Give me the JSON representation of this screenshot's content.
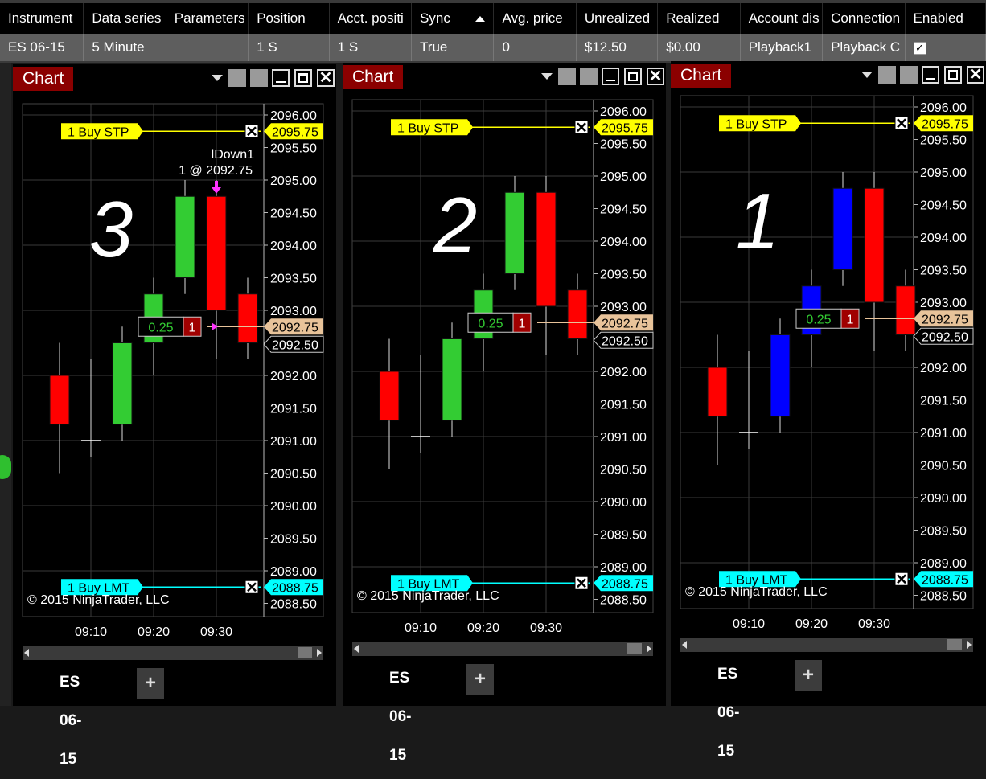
{
  "grid": {
    "columns": [
      "Instrument",
      "Data series",
      "Parameters",
      "Position",
      "Acct. positi",
      "Sync",
      "Avg. price",
      "Unrealized",
      "Realized",
      "Account dis",
      "Connection",
      "Enabled"
    ],
    "row": [
      "ES 06-15",
      "5 Minute",
      "",
      "1 S",
      "1 S",
      "True",
      "0",
      "$12.50",
      "$0.00",
      "Playback1",
      "Playback C",
      ""
    ]
  },
  "windows": [
    {
      "title": "Chart",
      "tab": "ES 06-15",
      "number": "3",
      "pos_qty": "1",
      "pos_pnl": "0.25",
      "trade_label": "lDown1",
      "trade_fill": "1 @ 2092.75"
    },
    {
      "title": "Chart",
      "tab": "ES 06-15",
      "number": "2",
      "pos_qty": "1",
      "pos_pnl": "0.25"
    },
    {
      "title": "Chart",
      "tab": "ES 06-15",
      "number": "1",
      "pos_qty": "1",
      "pos_pnl": "0.25"
    }
  ],
  "copyright": "© 2015 NinjaTrader, LLC",
  "plus_label": "+",
  "colors": {
    "up": "#33cc33",
    "down": "#ff0000",
    "up_blue": "#0000ff",
    "stop": "#ffff00",
    "limit": "#00ffff",
    "last": "#e8c39a",
    "title_red": "#8b0000"
  },
  "chart_data": [
    {
      "type": "candlestick",
      "x": [
        "09:10",
        "09:20",
        "09:30"
      ],
      "y_ticks": [
        "2096.00",
        "2095.50",
        "2095.00",
        "2094.50",
        "2094.00",
        "2093.50",
        "2093.00",
        "2092.50",
        "2092.00",
        "2091.50",
        "2091.00",
        "2090.50",
        "2090.00",
        "2089.50",
        "2089.00",
        "2088.50"
      ],
      "ylim": [
        2088.5,
        2096
      ],
      "candles": [
        {
          "o": 2092.0,
          "h": 2092.5,
          "l": 2090.5,
          "c": 2091.25
        },
        {
          "o": 2091.0,
          "h": 2092.25,
          "l": 2090.75,
          "c": 2091.0
        },
        {
          "o": 2091.25,
          "h": 2092.75,
          "l": 2091.0,
          "c": 2092.5
        },
        {
          "o": 2092.5,
          "h": 2093.5,
          "l": 2092.0,
          "c": 2093.25
        },
        {
          "o": 2093.5,
          "h": 2095.0,
          "l": 2093.25,
          "c": 2094.75
        },
        {
          "o": 2094.75,
          "h": 2095.0,
          "l": 2092.25,
          "c": 2093.0
        },
        {
          "o": 2093.25,
          "h": 2093.5,
          "l": 2092.25,
          "c": 2092.5
        }
      ],
      "orders": [
        {
          "label": "1 Buy STP",
          "price": "2095.75",
          "kind": "stop"
        },
        {
          "label": "1 Buy LMT",
          "price": "2088.75",
          "kind": "limit"
        }
      ],
      "last_price": "2092.75",
      "ask_price": "2092.50"
    },
    {
      "type": "candlestick",
      "x": [
        "09:10",
        "09:20",
        "09:30"
      ],
      "y_ticks": [
        "2096.00",
        "2095.50",
        "2095.00",
        "2094.50",
        "2094.00",
        "2093.50",
        "2093.00",
        "2092.50",
        "2092.00",
        "2091.50",
        "2091.00",
        "2090.50",
        "2090.00",
        "2089.50",
        "2089.00",
        "2088.50"
      ],
      "ylim": [
        2088.5,
        2096
      ],
      "candles": [
        {
          "o": 2092.0,
          "h": 2092.5,
          "l": 2090.5,
          "c": 2091.25
        },
        {
          "o": 2091.0,
          "h": 2092.25,
          "l": 2090.75,
          "c": 2091.0
        },
        {
          "o": 2091.25,
          "h": 2092.75,
          "l": 2091.0,
          "c": 2092.5
        },
        {
          "o": 2092.5,
          "h": 2093.5,
          "l": 2092.0,
          "c": 2093.25
        },
        {
          "o": 2093.5,
          "h": 2095.0,
          "l": 2093.25,
          "c": 2094.75
        },
        {
          "o": 2094.75,
          "h": 2095.0,
          "l": 2092.25,
          "c": 2093.0
        },
        {
          "o": 2093.25,
          "h": 2093.5,
          "l": 2092.25,
          "c": 2092.5
        }
      ],
      "orders": [
        {
          "label": "1 Buy STP",
          "price": "2095.75",
          "kind": "stop"
        },
        {
          "label": "1 Buy LMT",
          "price": "2088.75",
          "kind": "limit"
        }
      ],
      "last_price": "2092.75",
      "ask_price": "2092.50"
    },
    {
      "type": "candlestick",
      "x": [
        "09:10",
        "09:20",
        "09:30"
      ],
      "y_ticks": [
        "2096.00",
        "2095.50",
        "2095.00",
        "2094.50",
        "2094.00",
        "2093.50",
        "2093.00",
        "2092.50",
        "2092.00",
        "2091.50",
        "2091.00",
        "2090.50",
        "2090.00",
        "2089.50",
        "2089.00",
        "2088.50"
      ],
      "ylim": [
        2088.5,
        2096
      ],
      "up_color": "blue",
      "candles": [
        {
          "o": 2092.0,
          "h": 2092.5,
          "l": 2090.5,
          "c": 2091.25
        },
        {
          "o": 2091.0,
          "h": 2092.25,
          "l": 2090.75,
          "c": 2091.0
        },
        {
          "o": 2091.25,
          "h": 2092.75,
          "l": 2091.0,
          "c": 2092.5
        },
        {
          "o": 2092.5,
          "h": 2093.5,
          "l": 2092.0,
          "c": 2093.25
        },
        {
          "o": 2093.5,
          "h": 2095.0,
          "l": 2093.25,
          "c": 2094.75
        },
        {
          "o": 2094.75,
          "h": 2095.0,
          "l": 2092.25,
          "c": 2093.0
        },
        {
          "o": 2093.25,
          "h": 2093.5,
          "l": 2092.25,
          "c": 2092.5
        }
      ],
      "orders": [
        {
          "label": "1 Buy STP",
          "price": "2095.75",
          "kind": "stop"
        },
        {
          "label": "1 Buy LMT",
          "price": "2088.75",
          "kind": "limit"
        }
      ],
      "last_price": "2092.75",
      "ask_price": "2092.50"
    }
  ]
}
